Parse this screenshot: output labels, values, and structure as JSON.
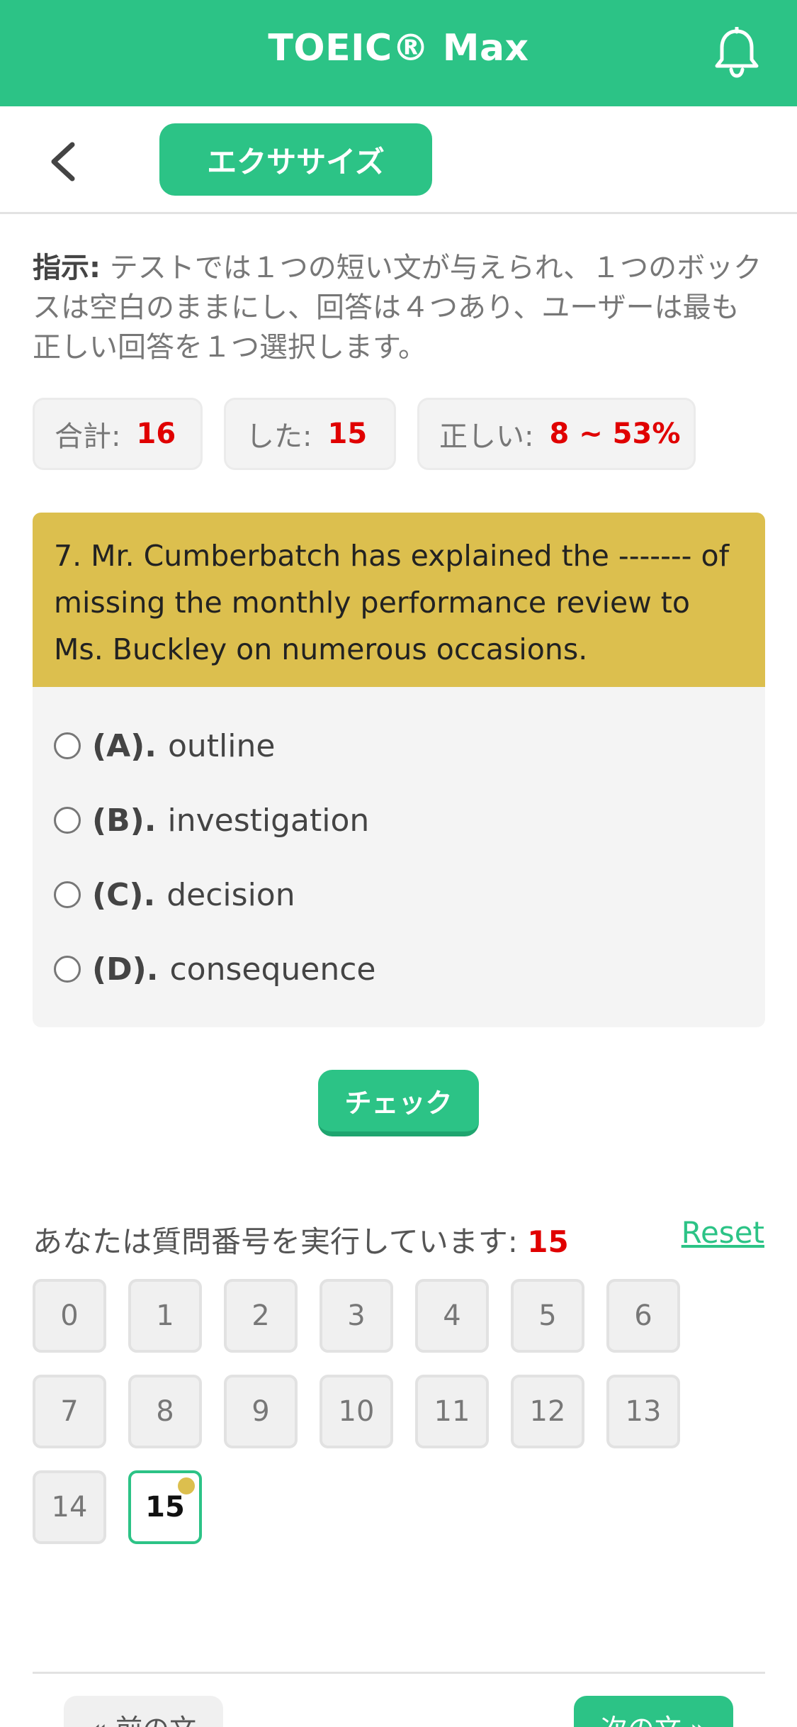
{
  "header": {
    "title": "TOEIC® Max",
    "notification_icon": "bell-icon"
  },
  "subbar": {
    "back_icon": "chevron-left-icon",
    "tab_label": "エクササイズ"
  },
  "instructions": {
    "label": "指示:",
    "text": " テストでは１つの短い文が与えられ、１つのボックスは空白のままにし、回答は４つあり、ユーザーは最も正しい回答を１つ選択します。"
  },
  "stats": {
    "total_label": "合計:",
    "total_value": "16",
    "done_label": "した:",
    "done_value": "15",
    "correct_label": "正しい:",
    "correct_value": "8 ~ 53%"
  },
  "question": {
    "text": "7. Mr. Cumberbatch has explained the ------- of missing the monthly performance review to Ms. Buckley on numerous occasions.",
    "options": [
      {
        "key": "(A).",
        "text": "outline"
      },
      {
        "key": "(B).",
        "text": "investigation"
      },
      {
        "key": "(C).",
        "text": "decision"
      },
      {
        "key": "(D).",
        "text": "consequence"
      }
    ]
  },
  "check_label": "チェック",
  "progress": {
    "running_label": "あなたは質問番号を実行しています: ",
    "running_value": "15",
    "reset_label": "Reset",
    "numbers": [
      "0",
      "1",
      "2",
      "3",
      "4",
      "5",
      "6",
      "7",
      "8",
      "9",
      "10",
      "11",
      "12",
      "13",
      "14",
      "15"
    ],
    "active": "15"
  },
  "nav": {
    "prev_label": "« 前の文",
    "next_label": "次の文 »"
  },
  "colors": {
    "brand": "#2cc386",
    "question_bg": "#dcbf4e",
    "highlight": "#e00000"
  }
}
